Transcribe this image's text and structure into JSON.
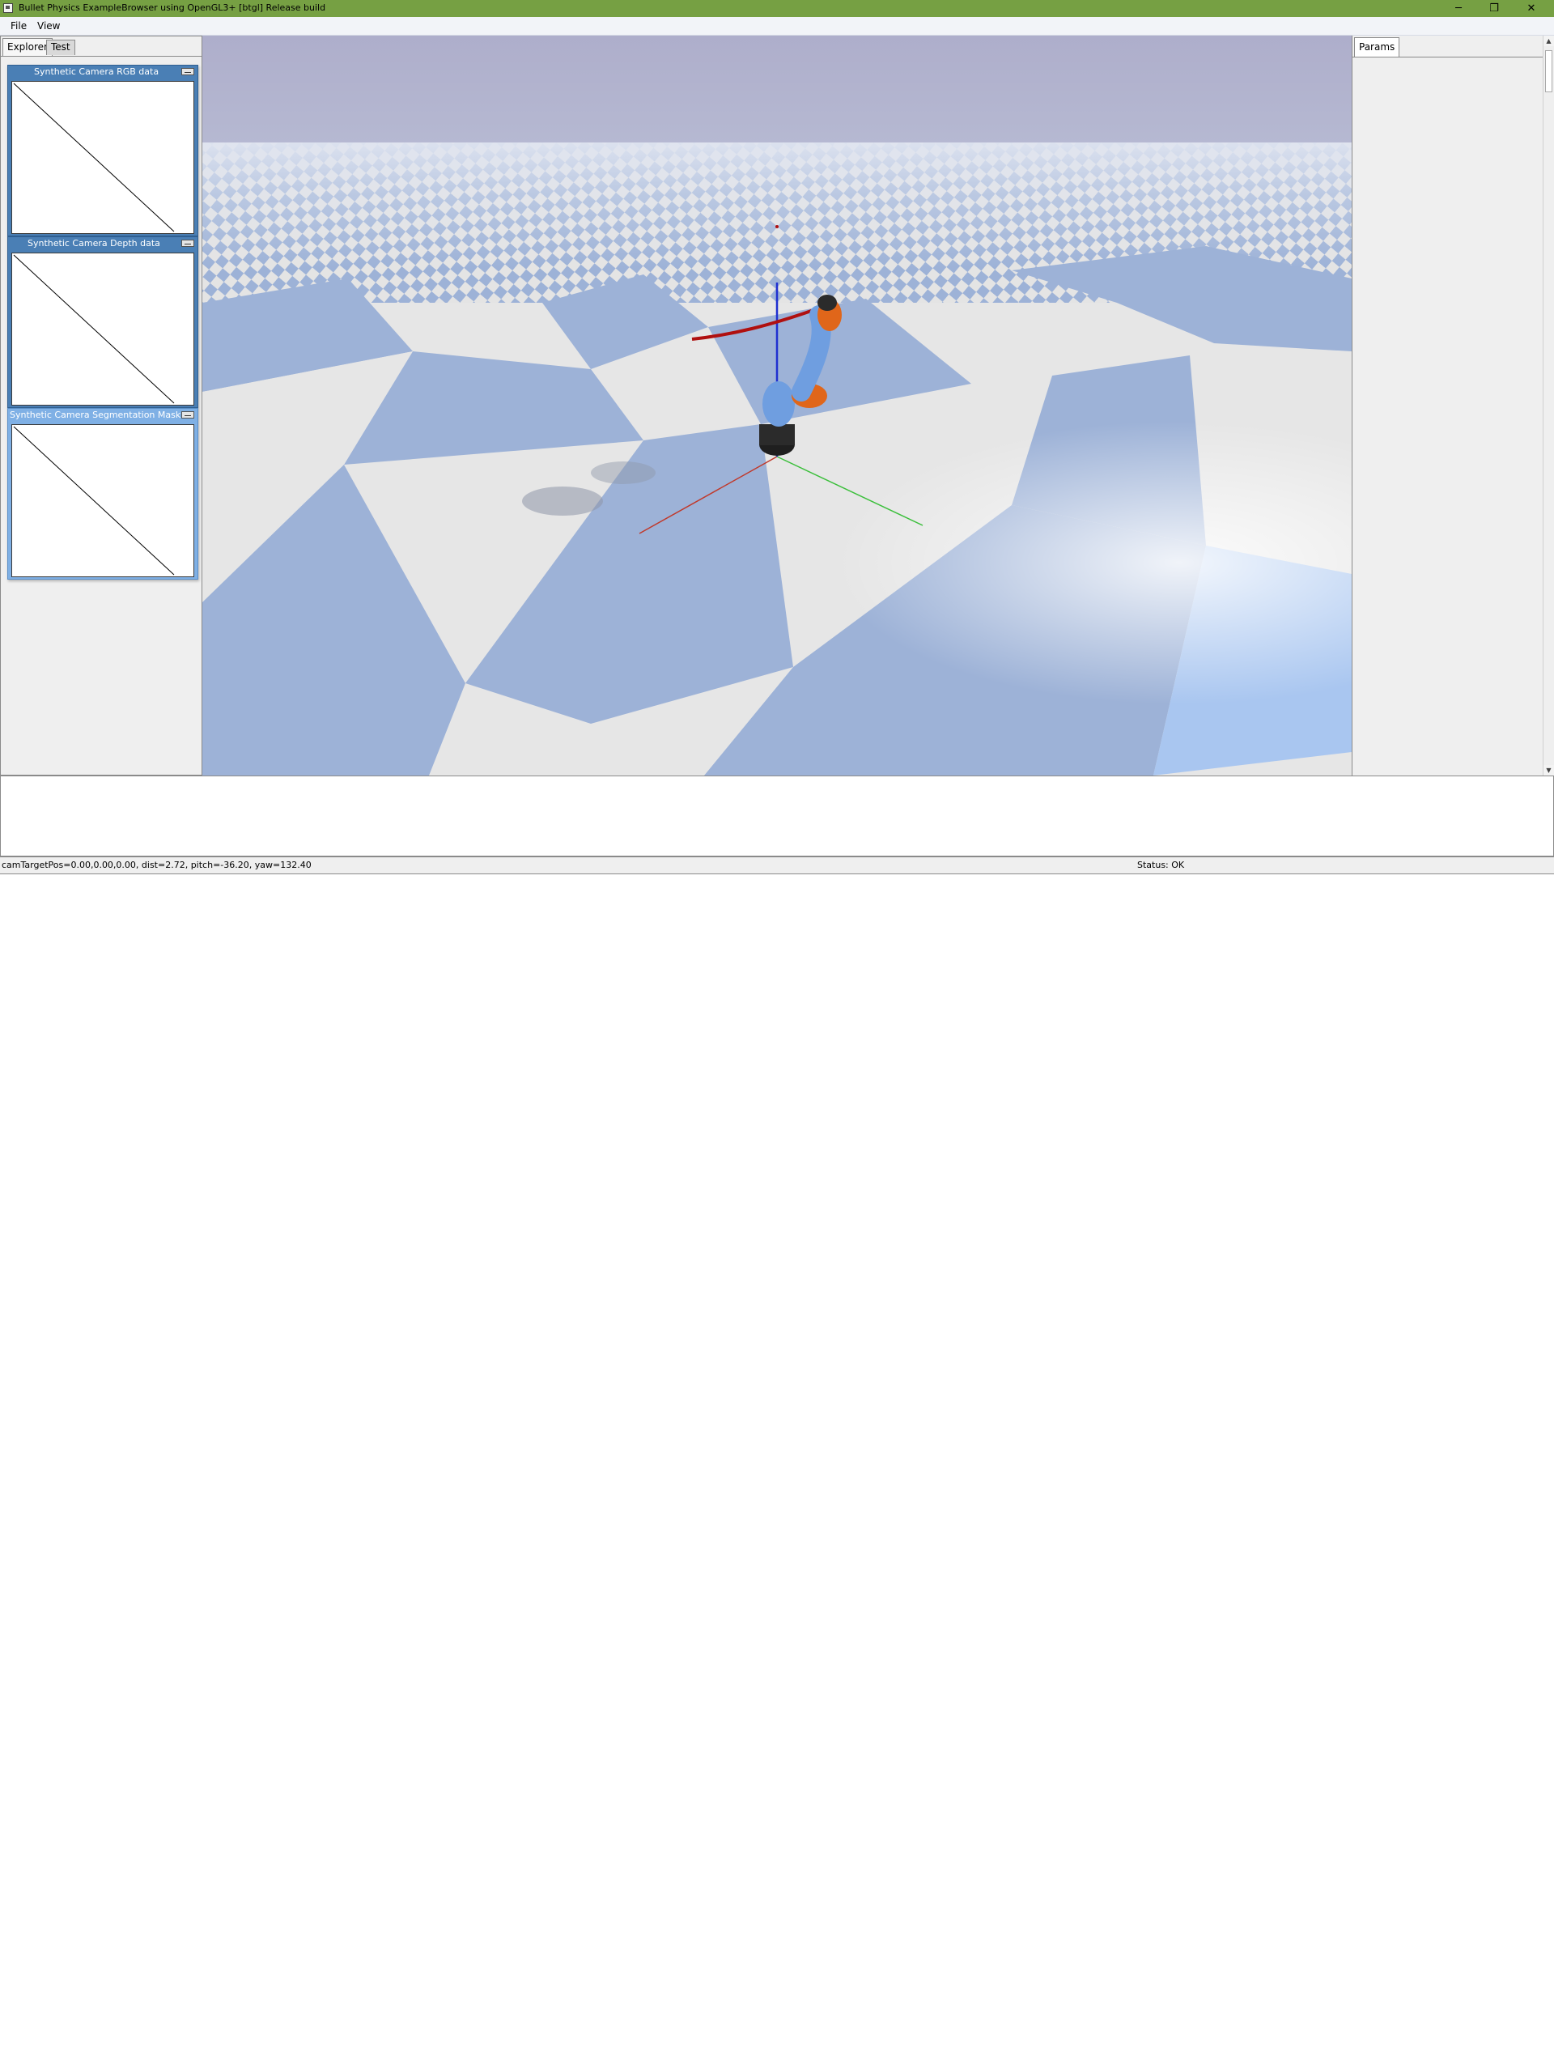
{
  "window": {
    "title": "Bullet Physics ExampleBrowser using OpenGL3+ [btgl] Release build",
    "minimize_glyph": "─",
    "maximize_glyph": "❐",
    "close_glyph": "✕"
  },
  "menu": {
    "items": [
      "File",
      "View"
    ]
  },
  "left_panel": {
    "tabs": [
      "Explorer",
      "Test"
    ],
    "camera_windows": [
      {
        "title": "Synthetic Camera RGB data"
      },
      {
        "title": "Synthetic Camera Depth data"
      },
      {
        "title": "Synthetic Camera Segmentation Mask"
      }
    ]
  },
  "right_panel": {
    "tab": "Params",
    "scroll_up_glyph": "▲",
    "scroll_down_glyph": "▼"
  },
  "status": {
    "camera": "camTargetPos=0.00,0.00,0.00, dist=2.72, pitch=-36.20, yaw=132.40",
    "state": "Status: OK"
  },
  "colors": {
    "titlebar": "#76a043",
    "sky": "#b0b1cd",
    "floor_blue": "#9cb2d6",
    "floor_white": "#e6e6e6",
    "robot_blue": "#6f9ee0",
    "robot_orange": "#e0661a"
  }
}
